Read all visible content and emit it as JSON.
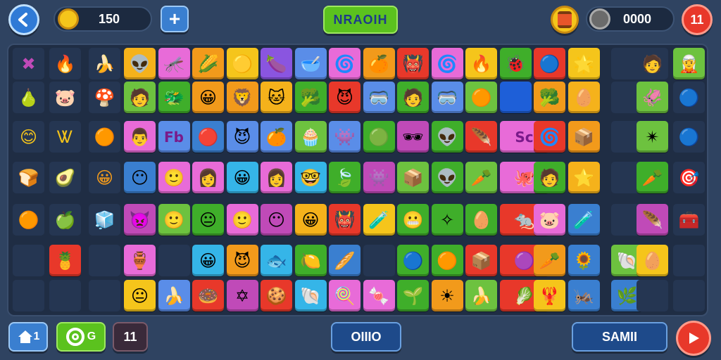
{
  "header": {
    "coins": "150",
    "title": "NRAOIH",
    "score": "0000",
    "lives": "11"
  },
  "footer": {
    "home_count": "1",
    "green_label": "G",
    "level": "11",
    "center_label": "OIIIO",
    "right_label": "SAMII"
  },
  "icons": {
    "back": "back-arrow-icon",
    "coin": "coin-icon",
    "add": "plus-icon",
    "barrel": "barrel-icon",
    "bomb": "bomb-icon",
    "home": "home-icon",
    "swirl": "swirl-icon",
    "next": "play-arrow-icon"
  },
  "colors": {
    "background": "#2f4361",
    "title_green": "#5bc21e",
    "lives_red": "#e8382a",
    "add_blue": "#3a7fd0",
    "next_red": "#e8382a"
  },
  "tiles": [
    [
      "dark",
      "✖",
      "#c04ab8"
    ],
    [
      "dark",
      "🔥",
      "#e8552a"
    ],
    [
      "dark",
      "🍌",
      "#f2c21b"
    ],
    [
      "#f5b21b",
      "👽",
      ""
    ],
    [
      "#e86bd8",
      "🦟",
      ""
    ],
    [
      "#f29a1b",
      "🌽",
      ""
    ],
    [
      "#f5c51b",
      "🟡",
      ""
    ],
    [
      "#8a55e0",
      "🍆",
      ""
    ],
    [
      "#5a8de8",
      "🥣",
      ""
    ],
    [
      "#e86bd8",
      "🌀",
      ""
    ],
    [
      "#f29a1b",
      "🍊",
      ""
    ],
    [
      "#e8382a",
      "👹",
      ""
    ],
    [
      "#e86bd8",
      "🌀",
      ""
    ],
    [
      "#f5c51b",
      "🔥",
      ""
    ],
    [
      "#3fae2a",
      "🐞",
      ""
    ],
    [
      "#e8382a",
      "🔵",
      ""
    ],
    [
      "#f5c51b",
      "🌟",
      ""
    ],
    [
      "dark",
      "",
      ""
    ],
    [
      "dark",
      "🧑",
      ""
    ],
    [
      "#6dc23f",
      "🧝",
      ""
    ],
    [
      "dark",
      "🍐",
      "#8bd81f"
    ],
    [
      "dark",
      "🐷",
      "#f2a58a"
    ],
    [
      "dark",
      "🍄",
      "#e87a2a"
    ],
    [
      "#6dc23f",
      "🧑",
      ""
    ],
    [
      "#3fae2a",
      "🐲",
      ""
    ],
    [
      "#f29a1b",
      "😀",
      ""
    ],
    [
      "#f29a1b",
      "🦁",
      ""
    ],
    [
      "#f5b21b",
      "🐱",
      ""
    ],
    [
      "#3fae2a",
      "🥦",
      ""
    ],
    [
      "#e8382a",
      "😈",
      ""
    ],
    [
      "#5a8de8",
      "🥽",
      ""
    ],
    [
      "#3fae2a",
      "🧑",
      ""
    ],
    [
      "#5a8de8",
      "🥽",
      ""
    ],
    [
      "#6dc23f",
      "🟠",
      ""
    ],
    [
      "#1e5fd8",
      "",
      ""
    ],
    [
      "#f29a1b",
      "🥦",
      ""
    ],
    [
      "#f5b21b",
      "🥚",
      ""
    ],
    [
      "dark",
      "",
      ""
    ],
    [
      "#6dc23f",
      "🦑",
      ""
    ],
    [
      "dark",
      "🔵",
      "#35a0e8"
    ],
    [
      "dark",
      "😊",
      "#f5c51b"
    ],
    [
      "dark",
      "Ꮤ",
      "#f2c21b"
    ],
    [
      "dark",
      "🟠",
      "#f29a1b"
    ],
    [
      "#e86bd8",
      "👨",
      ""
    ],
    [
      "#5a8de8",
      "Fb",
      ""
    ],
    [
      "#3a7fd0",
      "🔴",
      ""
    ],
    [
      "#5a8de8",
      "😈",
      ""
    ],
    [
      "#5a8de8",
      "🍊",
      ""
    ],
    [
      "#6dc23f",
      "🧁",
      ""
    ],
    [
      "#5a8de8",
      "👾",
      ""
    ],
    [
      "#3fae2a",
      "🟢",
      ""
    ],
    [
      "#c04ab8",
      "🕶",
      ""
    ],
    [
      "#3fae2a",
      "👽",
      ""
    ],
    [
      "#e8382a",
      "🪶",
      ""
    ],
    [
      "#e86bd8",
      "Sc",
      "wide"
    ],
    [
      "#e8382a",
      "🌀",
      ""
    ],
    [
      "#f29a1b",
      "📦",
      ""
    ],
    [
      "dark",
      "",
      ""
    ],
    [
      "#6dc23f",
      "✴",
      ""
    ],
    [
      "dark",
      "🔵",
      "#35a0e8"
    ],
    [
      "dark",
      "🍞",
      "#f2c21b"
    ],
    [
      "dark",
      "🥑",
      "#c04ab8"
    ],
    [
      "dark",
      "😀",
      "#f29a1b"
    ],
    [
      "#3a7fd0",
      "😶",
      ""
    ],
    [
      "#e86bd8",
      "🙂",
      ""
    ],
    [
      "#e86bd8",
      "👩",
      ""
    ],
    [
      "#35b5e8",
      "😀",
      ""
    ],
    [
      "#e86bd8",
      "👩",
      ""
    ],
    [
      "#35b5e8",
      "🤓",
      ""
    ],
    [
      "#3fae2a",
      "🍃",
      ""
    ],
    [
      "#c04ab8",
      "👾",
      ""
    ],
    [
      "#6dc23f",
      "📦",
      ""
    ],
    [
      "#3fae2a",
      "👽",
      ""
    ],
    [
      "#6dc23f",
      "🥕",
      ""
    ],
    [
      "#e86bd8",
      "🐙",
      "wide"
    ],
    [
      "#3fae2a",
      "🧑",
      ""
    ],
    [
      "#f5b21b",
      "⭐",
      ""
    ],
    [
      "dark",
      "",
      ""
    ],
    [
      "#3fae2a",
      "🥕",
      ""
    ],
    [
      "dark",
      "🎯",
      "#f29a1b"
    ],
    [
      "dark",
      "🟠",
      "#f2a01b"
    ],
    [
      "dark",
      "🍏",
      "#3fae2a"
    ],
    [
      "dark",
      "🧊",
      "#3a7fd0"
    ],
    [
      "#c04ab8",
      "👿",
      ""
    ],
    [
      "#6dc23f",
      "🙂",
      ""
    ],
    [
      "#3fae2a",
      "😐",
      ""
    ],
    [
      "#e86bd8",
      "🙂",
      ""
    ],
    [
      "#c04ab8",
      "😶",
      ""
    ],
    [
      "#f5b21b",
      "😀",
      ""
    ],
    [
      "#e8382a",
      "👹",
      ""
    ],
    [
      "#f5c51b",
      "🧪",
      ""
    ],
    [
      "#3fae2a",
      "😬",
      ""
    ],
    [
      "#3fae2a",
      "✧",
      ""
    ],
    [
      "#3fae2a",
      "🥚",
      ""
    ],
    [
      "#e8382a",
      "🐀",
      "wide"
    ],
    [
      "#e86bd8",
      "🐷",
      ""
    ],
    [
      "#3a7fd0",
      "🧪",
      ""
    ],
    [
      "dark",
      "",
      ""
    ],
    [
      "#c04ab8",
      "🪶",
      ""
    ],
    [
      "dark",
      "🧰",
      "#e8382a"
    ],
    [
      "dark",
      "",
      ""
    ],
    [
      "#e8382a",
      "🍍",
      ""
    ],
    [
      "dark",
      "",
      ""
    ],
    [
      "#e86bd8",
      "🏺",
      ""
    ],
    [
      "dark",
      "",
      ""
    ],
    [
      "#35b5e8",
      "😀",
      ""
    ],
    [
      "#f29a1b",
      "😈",
      ""
    ],
    [
      "#35b5e8",
      "🐟",
      ""
    ],
    [
      "#3fae2a",
      "🍋",
      ""
    ],
    [
      "#3a7fd0",
      "🥖",
      ""
    ],
    [
      "dark",
      "",
      ""
    ],
    [
      "#3fae2a",
      "🔵",
      ""
    ],
    [
      "#3fae2a",
      "🟠",
      ""
    ],
    [
      "#e8382a",
      "📦",
      ""
    ],
    [
      "#e8382a",
      "🟣",
      "wide"
    ],
    [
      "#f29a1b",
      "🥕",
      ""
    ],
    [
      "#3a7fd0",
      "🌻",
      ""
    ],
    [
      "#6dc23f",
      "🐚",
      ""
    ],
    [
      "#f5c51b",
      "🥚",
      ""
    ],
    [
      "dark",
      "",
      ""
    ],
    [
      "dark",
      "",
      ""
    ],
    [
      "dark",
      "",
      ""
    ],
    [
      "dark",
      "",
      ""
    ],
    [
      "#f5c51b",
      "😐",
      ""
    ],
    [
      "#5a8de8",
      "🍌",
      ""
    ],
    [
      "#e8382a",
      "🍩",
      ""
    ],
    [
      "#c04ab8",
      "✡",
      ""
    ],
    [
      "#e8382a",
      "🍪",
      ""
    ],
    [
      "#35b5e8",
      "🐚",
      ""
    ],
    [
      "#e86bd8",
      "🍭",
      ""
    ],
    [
      "#e86bd8",
      "🍬",
      ""
    ],
    [
      "#3fae2a",
      "🌱",
      ""
    ],
    [
      "#f29a1b",
      "☀",
      ""
    ],
    [
      "#6dc23f",
      "🍌",
      ""
    ],
    [
      "#e8382a",
      "🥬",
      "wide"
    ],
    [
      "#f5c51b",
      "🦞",
      ""
    ],
    [
      "#3a7fd0",
      "🦗",
      ""
    ],
    [
      "#3a7fd0",
      "🌿",
      ""
    ],
    [
      "dark",
      "",
      ""
    ],
    [
      "dark",
      "",
      ""
    ]
  ]
}
